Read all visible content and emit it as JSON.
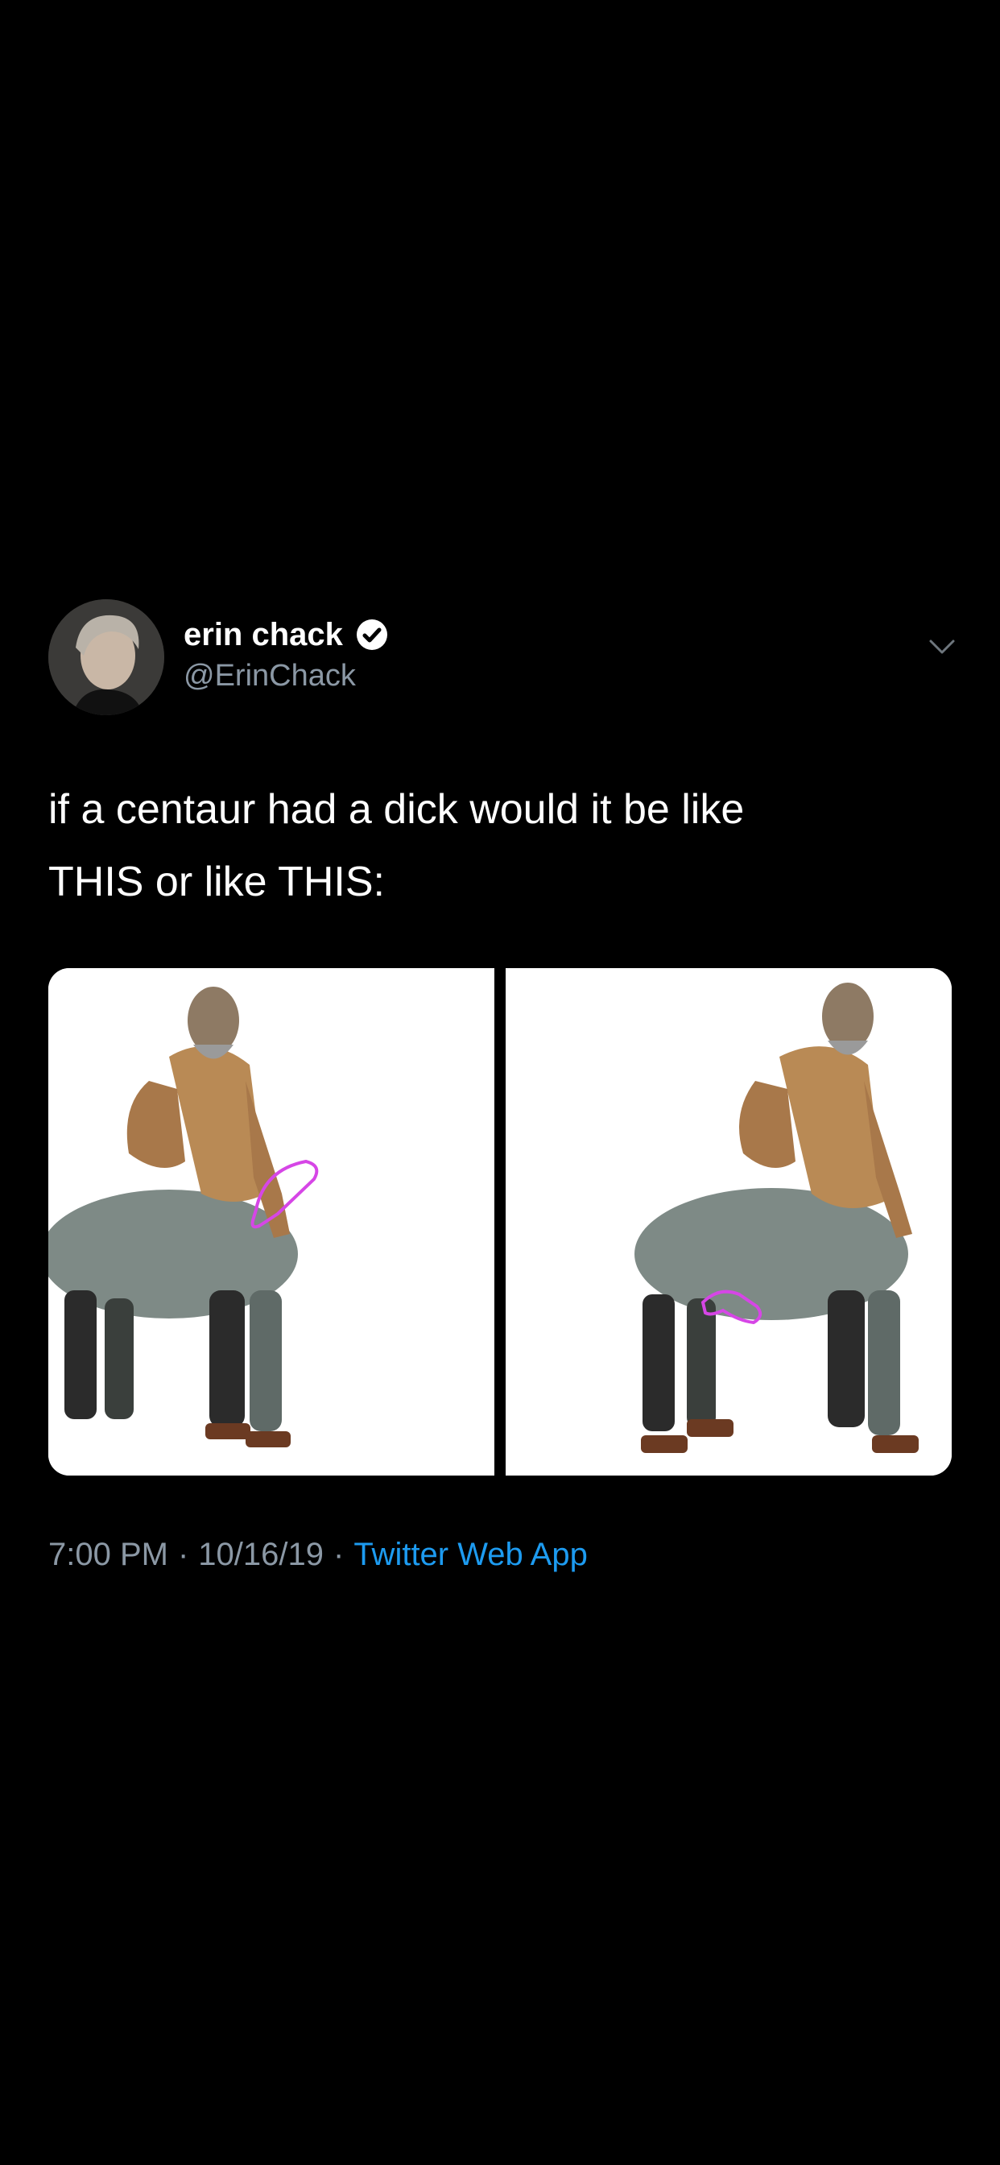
{
  "tweet": {
    "display_name": "erin chack",
    "verified": true,
    "handle": "@ErinChack",
    "text": "if a centaur had a dick would it be like\nTHIS or like THIS:",
    "time": "7:00 PM",
    "date": "10/16/19",
    "separator": "·",
    "source": "Twitter Web App"
  },
  "media": [
    {
      "name": "centaur-image-left",
      "overlay": "pink outline drawing near human torso"
    },
    {
      "name": "centaur-image-right",
      "overlay": "pink outline drawing near horse belly"
    }
  ],
  "colors": {
    "background": "#000000",
    "text": "#ffffff",
    "secondary_text": "#8b98a5",
    "link": "#1d9bf0",
    "overlay_stroke": "#d646e6"
  },
  "icons": [
    "verified-badge-icon",
    "chevron-down-icon"
  ]
}
